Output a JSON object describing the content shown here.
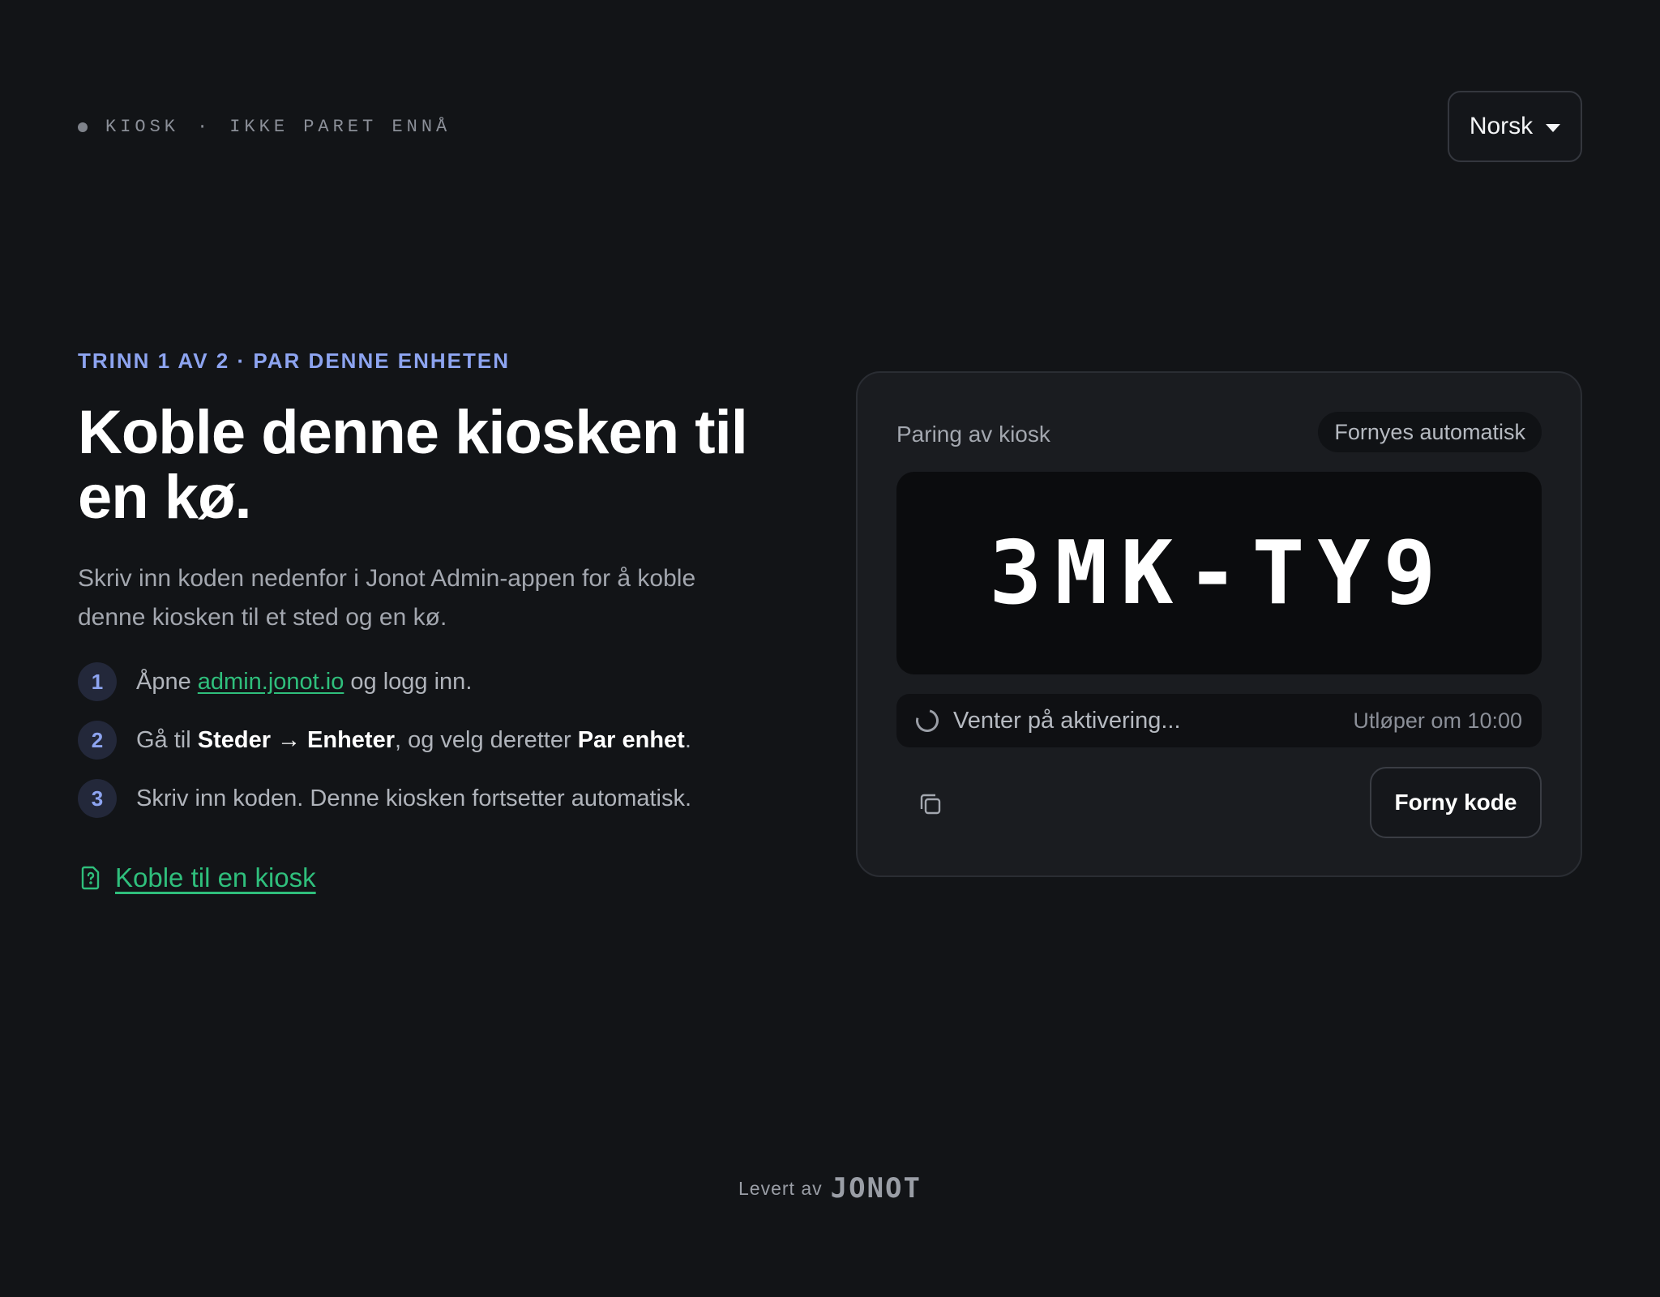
{
  "header": {
    "status_label": "KIOSK",
    "status_separator": "·",
    "pair_status": "IKKE PARET ENNÅ",
    "language": "Norsk"
  },
  "intro": {
    "eyebrow": "TRINN 1 AV 2 · PAR DENNE ENHETEN",
    "title": "Koble denne kiosken til en kø.",
    "lead": "Skriv inn koden nedenfor i Jonot Admin-appen for å koble denne kiosken til et sted og en kø."
  },
  "steps": [
    {
      "number": "1",
      "prefix": "Åpne ",
      "link": "admin.jonot.io",
      "suffix": " og logg inn."
    },
    {
      "number": "2",
      "prefix": "Gå til ",
      "bold1": "Steder",
      "arrow": "→",
      "bold2": "Enheter",
      "middle": ", og velg deretter ",
      "bold3": "Par enhet",
      "suffix": "."
    },
    {
      "number": "3",
      "text": "Skriv inn koden. Denne kiosken fortsetter automatisk."
    }
  ],
  "help_link": {
    "label": "Koble til en kiosk",
    "icon": "help-document-icon"
  },
  "card": {
    "title": "Paring av kiosk",
    "badge": "Fornyes automatisk",
    "code": "3MK-TY9",
    "waiting": "Venter på aktivering...",
    "expires": "Utløper om 10:00",
    "copy_icon": "copy-icon",
    "renew_label": "Forny kode"
  },
  "footer": {
    "label": "Levert av",
    "logo": "JONOT"
  },
  "colors": {
    "background": "#121417",
    "accent_blue": "#8da4f0",
    "accent_green": "#2fbf7c",
    "card": "#1a1c20"
  }
}
